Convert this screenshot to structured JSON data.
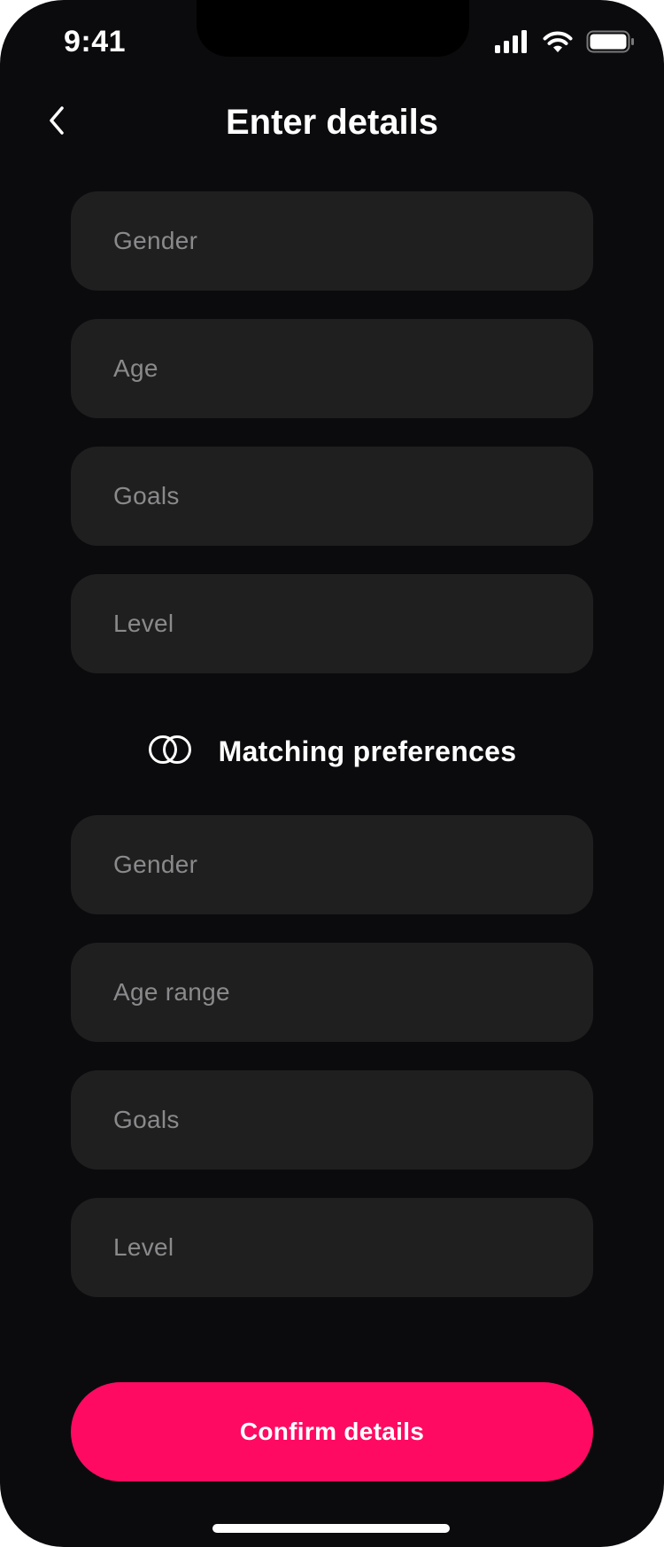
{
  "status_bar": {
    "time": "9:41",
    "icons": [
      "signal-icon",
      "wifi-icon",
      "battery-icon"
    ]
  },
  "header": {
    "back_icon": "chevron-left-icon",
    "title": "Enter details"
  },
  "details_fields": [
    {
      "label": "Gender"
    },
    {
      "label": "Age"
    },
    {
      "label": "Goals"
    },
    {
      "label": "Level"
    }
  ],
  "matching": {
    "icon": "overlapping-rings-icon",
    "heading": "Matching preferences",
    "fields": [
      {
        "label": "Gender"
      },
      {
        "label": "Age range"
      },
      {
        "label": "Goals"
      },
      {
        "label": "Level"
      }
    ]
  },
  "confirm": {
    "label": "Confirm details"
  },
  "colors": {
    "background": "#0b0b0d",
    "field_background": "#1f1f20",
    "placeholder_text": "#8a8a8c",
    "accent": "#ff0a62",
    "text": "#ffffff"
  }
}
